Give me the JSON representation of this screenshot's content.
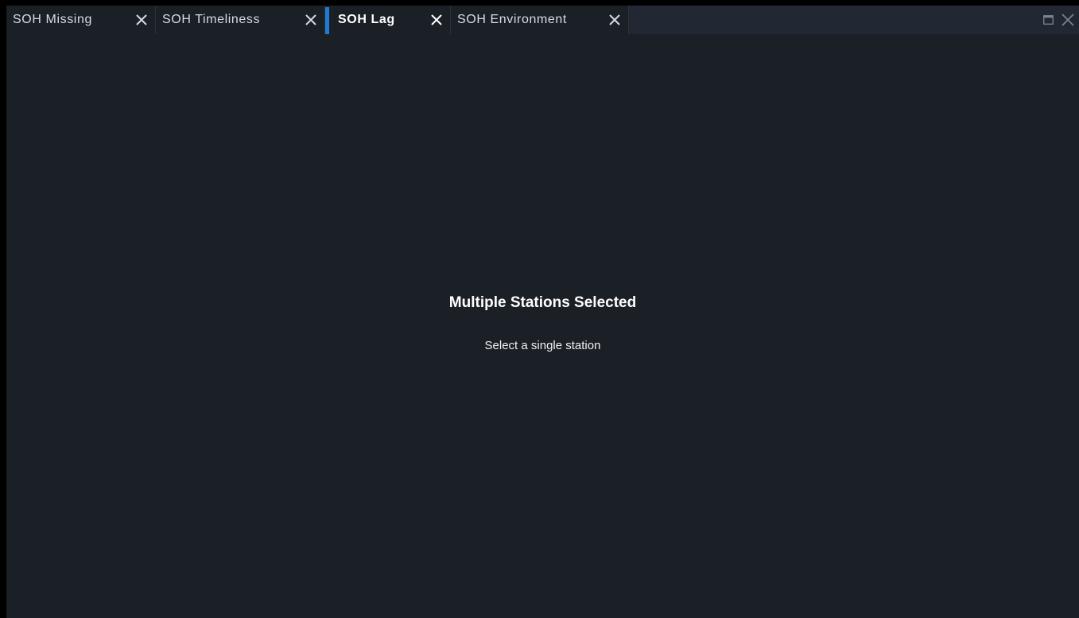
{
  "tabs": [
    {
      "label": "SOH Missing",
      "active": false
    },
    {
      "label": "SOH Timeliness",
      "active": false
    },
    {
      "label": "SOH Lag",
      "active": true
    },
    {
      "label": "SOH Environment",
      "active": false
    }
  ],
  "window_controls": {
    "maximize_icon": "maximize-icon",
    "close_icon": "close-icon"
  },
  "content": {
    "title": "Multiple Stations Selected",
    "subtitle": "Select a single station"
  },
  "colors": {
    "background": "#1b1f26",
    "tabbar": "#222833",
    "accent": "#1e7ad6",
    "text": "#ffffff"
  }
}
